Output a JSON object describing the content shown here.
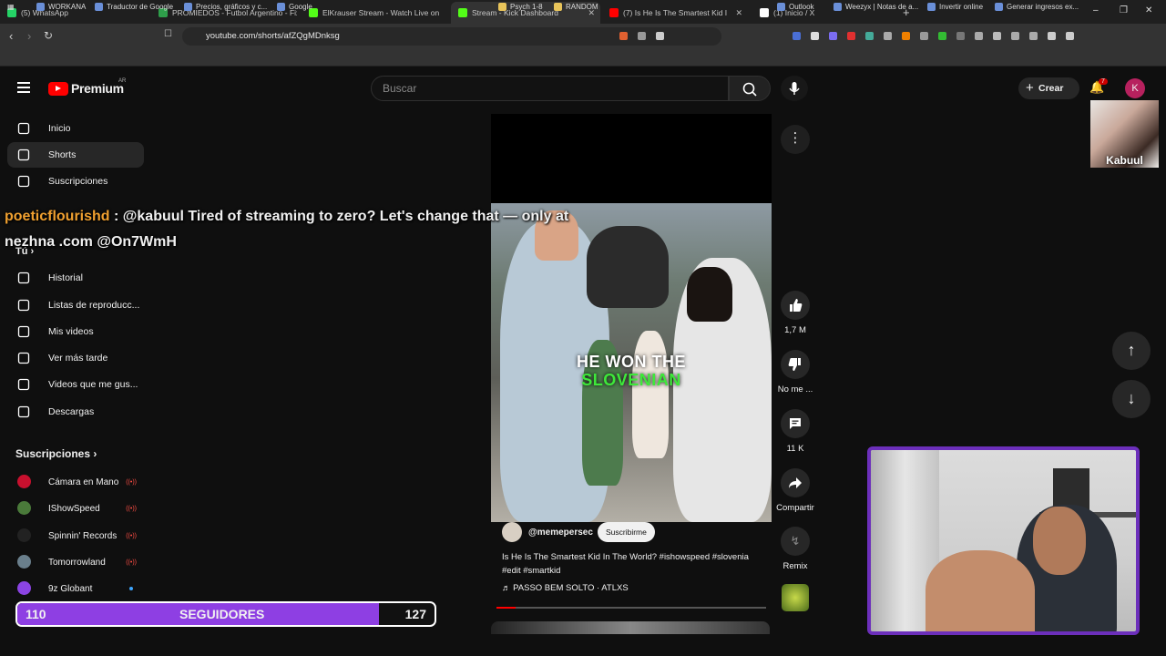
{
  "browser": {
    "tabs": [
      {
        "title": "(5) WhatsApp",
        "color": "#25d366"
      },
      {
        "title": "PROMIEDOS - Futbol Argentino - Fix",
        "color": "#2e9e4a"
      },
      {
        "title": "ElKrauser Stream - Watch Live on",
        "color": "#53fc18"
      },
      {
        "title": "Stream - Kick Dashboard",
        "color": "#53fc18"
      },
      {
        "title": "(7) Is He Is The Smartest Kid I",
        "color": "#ff0000"
      },
      {
        "title": "(1) Inicio / X",
        "color": "#ffffff"
      }
    ],
    "url": "youtube.com/shorts/afZQgMDnksg",
    "bookmarks": [
      "WORKANA",
      "Traductor de Google",
      "Precios, gráficos y c...",
      "Google",
      "Psych 1-8",
      "RANDOM",
      "Outlook",
      "Weezyx | Notas de a...",
      "Invertir online",
      "Generar ingresos ex..."
    ]
  },
  "masthead": {
    "logo_text": "Premium",
    "region": "AR",
    "search_placeholder": "Buscar",
    "create_label": "Crear",
    "notif_count": "7",
    "avatar_letter": "K"
  },
  "sidebar": {
    "main": [
      {
        "label": "Inicio",
        "icon": "home-icon"
      },
      {
        "label": "Shorts",
        "icon": "shorts-icon"
      },
      {
        "label": "Suscripciones",
        "icon": "subscriptions-icon"
      }
    ],
    "you_label": "Tú",
    "you_items": [
      {
        "label": "Historial",
        "icon": "history-icon"
      },
      {
        "label": "Listas de reproducc...",
        "icon": "playlists-icon"
      },
      {
        "label": "Mis videos",
        "icon": "my-videos-icon"
      },
      {
        "label": "Ver más tarde",
        "icon": "watch-later-icon"
      },
      {
        "label": "Videos que me gus...",
        "icon": "liked-icon"
      },
      {
        "label": "Descargas",
        "icon": "downloads-icon"
      }
    ],
    "subs_heading": "Suscripciones",
    "subs": [
      {
        "label": "Cámara en Mano",
        "color": "#c8102e",
        "live": true
      },
      {
        "label": "IShowSpeed",
        "color": "#4a7a3a",
        "live": true
      },
      {
        "label": "Spinnin' Records",
        "color": "#222222",
        "live": true
      },
      {
        "label": "Tomorrowland",
        "color": "#6a7f8c",
        "live": true
      },
      {
        "label": "9z Globant",
        "color": "#8b44e3",
        "live": false
      }
    ]
  },
  "short": {
    "overlay_line1": "HE WON THE",
    "overlay_line2": "SLOVENIAN",
    "channel": "@memepersec",
    "subscribe_label": "Suscribirme",
    "title": "Is He Is The Smartest Kid In The World? #ishowspeed #slovenia #edit #smartkid",
    "music": "PASSO BEM SOLTO · ATLXS",
    "progress": 0.07
  },
  "actions": {
    "likes": "1,7 M",
    "dislike_label": "No me ...",
    "comments": "11 K",
    "share_label": "Compartir",
    "remix_label": "Remix"
  },
  "overlay": {
    "chat_user": "poeticflourishd",
    "chat_text": ": @kabuul Tired of streaming to zero? Let's change that — only at nezhna .com @On7WmH",
    "kabuul_label": "Kabuul",
    "followers_label": "SEGUIDORES",
    "followers_current": "110",
    "followers_goal": "127",
    "followers_fraction": 0.866
  }
}
